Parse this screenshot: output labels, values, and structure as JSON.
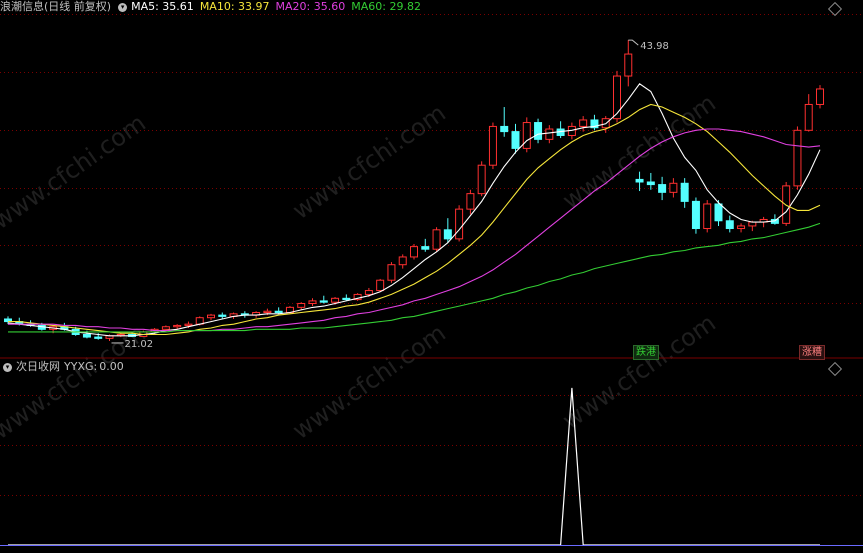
{
  "header": {
    "title": "浪潮信息(日线 前复权)",
    "ma": [
      {
        "label": "MA5:",
        "value": "35.61",
        "color": "#ffffff"
      },
      {
        "label": "MA10:",
        "value": "33.97",
        "color": "#f5e53a"
      },
      {
        "label": "MA20:",
        "value": "35.60",
        "color": "#e040e0"
      },
      {
        "label": "MA60:",
        "value": "29.82",
        "color": "#33cc33"
      }
    ]
  },
  "sub_header": {
    "title": "次日收网",
    "indicator_label": "YYXG:",
    "indicator_value": "0.00"
  },
  "annotations": {
    "high_label": "43.98",
    "low_label": "21.02",
    "badge_down": "跌港",
    "badge_up": "涨糟"
  },
  "watermark": "www.cfchi.com",
  "colors": {
    "up": "#ff3030",
    "down": "#54ffff",
    "grid": "#7a0000",
    "ma5": "#ffffff",
    "ma10": "#f5e53a",
    "ma20": "#e040e0",
    "ma60": "#33cc33",
    "text": "#c0c0c0",
    "badge_down": "#33cc33",
    "badge_up": "#ff3030"
  },
  "chart_data": [
    {
      "type": "candlestick",
      "title": "浪潮信息(日线 前复权)",
      "ylim": [
        20,
        46
      ],
      "candles": [
        [
          22.4,
          22.6,
          22.0,
          22.2
        ],
        [
          22.2,
          22.5,
          21.9,
          22.0
        ],
        [
          22.0,
          22.3,
          21.8,
          21.9
        ],
        [
          21.9,
          22.1,
          21.5,
          21.6
        ],
        [
          21.6,
          21.9,
          21.3,
          21.8
        ],
        [
          21.8,
          22.1,
          21.5,
          21.6
        ],
        [
          21.6,
          21.8,
          21.1,
          21.2
        ],
        [
          21.2,
          21.5,
          20.9,
          21.0
        ],
        [
          21.0,
          21.3,
          20.8,
          20.9
        ],
        [
          20.9,
          21.2,
          20.7,
          21.1
        ],
        [
          21.1,
          21.3,
          21.0,
          21.2
        ],
        [
          21.2,
          21.4,
          21.0,
          21.05
        ],
        [
          21.05,
          21.5,
          21.02,
          21.4
        ],
        [
          21.4,
          21.7,
          21.2,
          21.6
        ],
        [
          21.6,
          21.9,
          21.4,
          21.8
        ],
        [
          21.8,
          22.0,
          21.6,
          21.9
        ],
        [
          21.9,
          22.2,
          21.7,
          22.0
        ],
        [
          22.0,
          22.6,
          21.9,
          22.5
        ],
        [
          22.5,
          22.8,
          22.3,
          22.7
        ],
        [
          22.7,
          22.9,
          22.4,
          22.6
        ],
        [
          22.6,
          22.9,
          22.4,
          22.8
        ],
        [
          22.8,
          23.0,
          22.5,
          22.7
        ],
        [
          22.7,
          23.0,
          22.5,
          22.9
        ],
        [
          22.9,
          23.2,
          22.7,
          23.0
        ],
        [
          23.0,
          23.3,
          22.8,
          22.9
        ],
        [
          22.9,
          23.4,
          22.8,
          23.3
        ],
        [
          23.3,
          23.7,
          23.1,
          23.6
        ],
        [
          23.6,
          24.0,
          23.4,
          23.8
        ],
        [
          23.8,
          24.2,
          23.6,
          23.7
        ],
        [
          23.7,
          24.1,
          23.5,
          24.0
        ],
        [
          24.0,
          24.3,
          23.8,
          23.9
        ],
        [
          23.9,
          24.4,
          23.8,
          24.3
        ],
        [
          24.3,
          24.8,
          24.1,
          24.6
        ],
        [
          24.6,
          25.5,
          24.5,
          25.4
        ],
        [
          25.4,
          26.8,
          25.2,
          26.6
        ],
        [
          26.6,
          27.4,
          26.3,
          27.2
        ],
        [
          27.2,
          28.2,
          27.0,
          28.0
        ],
        [
          28.0,
          28.6,
          27.6,
          27.8
        ],
        [
          27.8,
          29.5,
          27.6,
          29.3
        ],
        [
          29.3,
          30.2,
          28.3,
          28.6
        ],
        [
          28.6,
          31.2,
          28.4,
          30.9
        ],
        [
          30.9,
          32.4,
          30.5,
          32.1
        ],
        [
          32.1,
          34.6,
          31.9,
          34.3
        ],
        [
          34.3,
          37.6,
          34.0,
          37.3
        ],
        [
          37.3,
          38.8,
          36.5,
          36.9
        ],
        [
          36.9,
          37.5,
          35.2,
          35.6
        ],
        [
          35.6,
          38.0,
          35.3,
          37.6
        ],
        [
          37.6,
          37.9,
          36.0,
          36.3
        ],
        [
          36.3,
          37.4,
          36.0,
          37.1
        ],
        [
          37.1,
          37.7,
          36.4,
          36.6
        ],
        [
          36.6,
          37.6,
          36.3,
          37.3
        ],
        [
          37.3,
          38.1,
          36.9,
          37.8
        ],
        [
          37.8,
          38.2,
          37.0,
          37.2
        ],
        [
          37.2,
          38.1,
          36.8,
          37.9
        ],
        [
          37.9,
          41.6,
          37.6,
          41.2
        ],
        [
          41.2,
          43.98,
          40.4,
          42.9
        ],
        [
          33.2,
          33.8,
          32.3,
          33.0
        ],
        [
          33.0,
          33.7,
          32.4,
          32.8
        ],
        [
          32.8,
          33.4,
          31.6,
          32.2
        ],
        [
          32.2,
          33.3,
          31.8,
          32.9
        ],
        [
          32.9,
          33.3,
          31.0,
          31.5
        ],
        [
          31.5,
          31.8,
          29.0,
          29.4
        ],
        [
          29.4,
          31.6,
          29.1,
          31.3
        ],
        [
          31.3,
          31.6,
          29.6,
          30.0
        ],
        [
          30.0,
          30.4,
          29.1,
          29.4
        ],
        [
          29.4,
          29.8,
          29.1,
          29.6
        ],
        [
          29.6,
          30.0,
          29.2,
          29.9
        ],
        [
          29.9,
          30.3,
          29.5,
          30.1
        ],
        [
          30.1,
          30.5,
          29.7,
          29.8
        ],
        [
          29.8,
          33.0,
          29.6,
          32.7
        ],
        [
          32.7,
          37.3,
          32.4,
          37.0
        ],
        [
          37.0,
          39.8,
          36.9,
          39.0
        ],
        [
          39.0,
          40.5,
          38.7,
          40.2
        ]
      ],
      "ma_series": [
        {
          "name": "MA5",
          "values": [
            22.1,
            22.0,
            21.9,
            21.8,
            21.7,
            21.6,
            21.4,
            21.3,
            21.2,
            21.1,
            21.1,
            21.1,
            21.2,
            21.3,
            21.5,
            21.6,
            21.8,
            22.0,
            22.2,
            22.4,
            22.6,
            22.7,
            22.7,
            22.8,
            22.8,
            22.9,
            23.1,
            23.3,
            23.4,
            23.6,
            23.8,
            24.0,
            24.2,
            24.5,
            25.0,
            25.6,
            26.3,
            27.0,
            27.6,
            28.3,
            29.3,
            30.4,
            31.5,
            32.9,
            34.2,
            35.3,
            36.2,
            36.7,
            36.8,
            36.9,
            37.0,
            37.2,
            37.3,
            37.5,
            38.3,
            39.4,
            40.6,
            40.0,
            38.3,
            36.4,
            34.9,
            33.9,
            32.4,
            31.4,
            30.6,
            30.1,
            29.9,
            29.9,
            30.0,
            30.7,
            32.0,
            33.6,
            35.5
          ]
        },
        {
          "name": "MA10",
          "values": [
            22.2,
            22.2,
            22.1,
            22.0,
            21.9,
            21.8,
            21.7,
            21.6,
            21.5,
            21.4,
            21.3,
            21.3,
            21.2,
            21.2,
            21.2,
            21.3,
            21.4,
            21.6,
            21.7,
            21.9,
            22.0,
            22.2,
            22.4,
            22.5,
            22.7,
            22.8,
            22.9,
            23.0,
            23.1,
            23.2,
            23.4,
            23.5,
            23.7,
            24.0,
            24.3,
            24.7,
            25.1,
            25.6,
            26.1,
            26.7,
            27.4,
            28.1,
            28.9,
            29.9,
            31.0,
            32.1,
            33.2,
            34.1,
            34.8,
            35.5,
            36.1,
            36.6,
            36.9,
            37.1,
            37.5,
            38.0,
            38.6,
            39.0,
            38.8,
            38.4,
            38.0,
            37.5,
            36.9,
            36.1,
            35.3,
            34.4,
            33.5,
            32.7,
            31.9,
            31.2,
            30.8,
            30.8,
            31.2
          ]
        },
        {
          "name": "MA20",
          "values": [
            22.0,
            22.0,
            22.0,
            22.0,
            22.0,
            21.9,
            21.9,
            21.8,
            21.8,
            21.7,
            21.7,
            21.6,
            21.6,
            21.5,
            21.5,
            21.5,
            21.5,
            21.5,
            21.5,
            21.6,
            21.6,
            21.7,
            21.8,
            21.8,
            21.9,
            22.0,
            22.1,
            22.2,
            22.3,
            22.5,
            22.6,
            22.8,
            22.9,
            23.1,
            23.3,
            23.5,
            23.8,
            24.0,
            24.3,
            24.6,
            24.9,
            25.3,
            25.7,
            26.2,
            26.8,
            27.4,
            28.1,
            28.8,
            29.5,
            30.2,
            30.9,
            31.6,
            32.3,
            32.9,
            33.6,
            34.3,
            35.0,
            35.6,
            36.1,
            36.5,
            36.8,
            37.0,
            37.1,
            37.1,
            37.0,
            36.9,
            36.7,
            36.5,
            36.2,
            35.9,
            35.8,
            35.7,
            35.8
          ]
        },
        {
          "name": "MA60",
          "values": [
            21.4,
            21.4,
            21.4,
            21.4,
            21.4,
            21.4,
            21.4,
            21.4,
            21.4,
            21.4,
            21.4,
            21.4,
            21.4,
            21.4,
            21.4,
            21.5,
            21.5,
            21.5,
            21.5,
            21.5,
            21.5,
            21.5,
            21.6,
            21.6,
            21.6,
            21.6,
            21.7,
            21.7,
            21.7,
            21.8,
            21.9,
            22.0,
            22.1,
            22.2,
            22.3,
            22.5,
            22.6,
            22.8,
            23.0,
            23.2,
            23.4,
            23.6,
            23.8,
            24.0,
            24.3,
            24.5,
            24.8,
            25.0,
            25.3,
            25.5,
            25.8,
            26.0,
            26.3,
            26.5,
            26.7,
            26.9,
            27.1,
            27.3,
            27.4,
            27.6,
            27.7,
            27.9,
            28.0,
            28.1,
            28.3,
            28.4,
            28.6,
            28.7,
            28.9,
            29.1,
            29.3,
            29.5,
            29.8
          ]
        }
      ]
    },
    {
      "type": "line",
      "title": "次日收网",
      "series": [
        {
          "name": "YYXG",
          "values": [
            0,
            0,
            0,
            0,
            0,
            0,
            0,
            0,
            0,
            0,
            0,
            0,
            0,
            0,
            0,
            0,
            0,
            0,
            0,
            0,
            0,
            0,
            0,
            0,
            0,
            0,
            0,
            0,
            0,
            0,
            0,
            0,
            0,
            0,
            0,
            0,
            0,
            0,
            0,
            0,
            0,
            0,
            0,
            0,
            0,
            0,
            0,
            0,
            0,
            0,
            1,
            0,
            0,
            0,
            0,
            0,
            0,
            0,
            0,
            0,
            0,
            0,
            0,
            0,
            0,
            0,
            0,
            0,
            0,
            0,
            0,
            0,
            0
          ]
        }
      ],
      "ylim": [
        0,
        1.05
      ]
    }
  ]
}
